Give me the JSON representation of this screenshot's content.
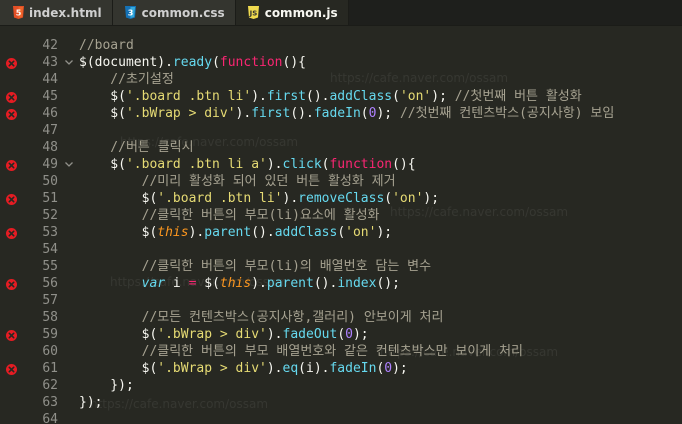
{
  "tabs": [
    {
      "label": "index.html",
      "icon": "html5-icon",
      "active": false
    },
    {
      "label": "common.css",
      "icon": "css3-icon",
      "active": false
    },
    {
      "label": "common.js",
      "icon": "js-icon",
      "active": true
    }
  ],
  "watermark_text": "https://cafe.naver.com/ossam",
  "lines": [
    {
      "num": "42",
      "err": false,
      "fold": false,
      "tokens": [
        {
          "t": "//board",
          "c": "c-cmt"
        }
      ]
    },
    {
      "num": "43",
      "err": true,
      "fold": true,
      "tokens": [
        {
          "t": "$(document).",
          "c": ""
        },
        {
          "t": "ready",
          "c": "c-fn"
        },
        {
          "t": "(",
          "c": ""
        },
        {
          "t": "function",
          "c": "c-kw"
        },
        {
          "t": "(){",
          "c": ""
        }
      ]
    },
    {
      "num": "44",
      "err": false,
      "fold": false,
      "tokens": [
        {
          "t": "    //초기설정",
          "c": "c-cmt"
        }
      ]
    },
    {
      "num": "45",
      "err": true,
      "fold": false,
      "tokens": [
        {
          "t": "    $(",
          "c": ""
        },
        {
          "t": "'.board .btn li'",
          "c": "c-str"
        },
        {
          "t": ").",
          "c": ""
        },
        {
          "t": "first",
          "c": "c-fn"
        },
        {
          "t": "().",
          "c": ""
        },
        {
          "t": "addClass",
          "c": "c-fn"
        },
        {
          "t": "(",
          "c": ""
        },
        {
          "t": "'on'",
          "c": "c-str"
        },
        {
          "t": "); ",
          "c": ""
        },
        {
          "t": "//첫번째 버튼 활성화",
          "c": "c-cmt"
        }
      ]
    },
    {
      "num": "46",
      "err": true,
      "fold": false,
      "tokens": [
        {
          "t": "    $(",
          "c": ""
        },
        {
          "t": "'.bWrap > div'",
          "c": "c-str"
        },
        {
          "t": ").",
          "c": ""
        },
        {
          "t": "first",
          "c": "c-fn"
        },
        {
          "t": "().",
          "c": ""
        },
        {
          "t": "fadeIn",
          "c": "c-fn"
        },
        {
          "t": "(",
          "c": ""
        },
        {
          "t": "0",
          "c": "c-num"
        },
        {
          "t": "); ",
          "c": ""
        },
        {
          "t": "//첫번째 컨텐츠박스(공지사항) 보임",
          "c": "c-cmt"
        }
      ]
    },
    {
      "num": "47",
      "err": false,
      "fold": false,
      "tokens": []
    },
    {
      "num": "48",
      "err": false,
      "fold": false,
      "tokens": [
        {
          "t": "    //버튼 클릭시",
          "c": "c-cmt"
        }
      ]
    },
    {
      "num": "49",
      "err": true,
      "fold": true,
      "tokens": [
        {
          "t": "    $(",
          "c": ""
        },
        {
          "t": "'.board .btn li a'",
          "c": "c-str"
        },
        {
          "t": ").",
          "c": ""
        },
        {
          "t": "click",
          "c": "c-fn"
        },
        {
          "t": "(",
          "c": ""
        },
        {
          "t": "function",
          "c": "c-kw"
        },
        {
          "t": "(){",
          "c": ""
        }
      ]
    },
    {
      "num": "50",
      "err": false,
      "fold": false,
      "tokens": [
        {
          "t": "        //미리 활성화 되어 있던 버튼 활성화 제거",
          "c": "c-cmt"
        }
      ]
    },
    {
      "num": "51",
      "err": true,
      "fold": false,
      "tokens": [
        {
          "t": "        $(",
          "c": ""
        },
        {
          "t": "'.board .btn li'",
          "c": "c-str"
        },
        {
          "t": ").",
          "c": ""
        },
        {
          "t": "removeClass",
          "c": "c-fn"
        },
        {
          "t": "(",
          "c": ""
        },
        {
          "t": "'on'",
          "c": "c-str"
        },
        {
          "t": ");",
          "c": ""
        }
      ]
    },
    {
      "num": "52",
      "err": false,
      "fold": false,
      "tokens": [
        {
          "t": "        //클릭한 버튼의 부모(li)요소에 활성화",
          "c": "c-cmt"
        }
      ]
    },
    {
      "num": "53",
      "err": true,
      "fold": false,
      "tokens": [
        {
          "t": "        $(",
          "c": ""
        },
        {
          "t": "this",
          "c": "c-this"
        },
        {
          "t": ").",
          "c": ""
        },
        {
          "t": "parent",
          "c": "c-fn"
        },
        {
          "t": "().",
          "c": ""
        },
        {
          "t": "addClass",
          "c": "c-fn"
        },
        {
          "t": "(",
          "c": ""
        },
        {
          "t": "'on'",
          "c": "c-str"
        },
        {
          "t": ");",
          "c": ""
        }
      ]
    },
    {
      "num": "54",
      "err": false,
      "fold": false,
      "tokens": []
    },
    {
      "num": "55",
      "err": false,
      "fold": false,
      "tokens": [
        {
          "t": "        //클릭한 버튼의 부모(li)의 배열번호 담는 변수",
          "c": "c-cmt"
        }
      ]
    },
    {
      "num": "56",
      "err": true,
      "fold": false,
      "tokens": [
        {
          "t": "        ",
          "c": ""
        },
        {
          "t": "var",
          "c": "c-var"
        },
        {
          "t": " i ",
          "c": ""
        },
        {
          "t": "=",
          "c": "c-kw"
        },
        {
          "t": " $(",
          "c": ""
        },
        {
          "t": "this",
          "c": "c-this"
        },
        {
          "t": ").",
          "c": ""
        },
        {
          "t": "parent",
          "c": "c-fn"
        },
        {
          "t": "().",
          "c": ""
        },
        {
          "t": "index",
          "c": "c-fn"
        },
        {
          "t": "();",
          "c": ""
        }
      ]
    },
    {
      "num": "57",
      "err": false,
      "fold": false,
      "tokens": []
    },
    {
      "num": "58",
      "err": false,
      "fold": false,
      "tokens": [
        {
          "t": "        //모든 컨텐츠박스(공지사항,갤러리) 안보이게 처리",
          "c": "c-cmt"
        }
      ]
    },
    {
      "num": "59",
      "err": true,
      "fold": false,
      "tokens": [
        {
          "t": "        $(",
          "c": ""
        },
        {
          "t": "'.bWrap > div'",
          "c": "c-str"
        },
        {
          "t": ").",
          "c": ""
        },
        {
          "t": "fadeOut",
          "c": "c-fn"
        },
        {
          "t": "(",
          "c": ""
        },
        {
          "t": "0",
          "c": "c-num"
        },
        {
          "t": ");",
          "c": ""
        }
      ]
    },
    {
      "num": "60",
      "err": false,
      "fold": false,
      "tokens": [
        {
          "t": "        //클릭한 버튼의 부모 배열번호와 같은 컨텐츠박스만 보이게 처리",
          "c": "c-cmt"
        }
      ]
    },
    {
      "num": "61",
      "err": true,
      "fold": false,
      "tokens": [
        {
          "t": "        $(",
          "c": ""
        },
        {
          "t": "'.bWrap > div'",
          "c": "c-str"
        },
        {
          "t": ").",
          "c": ""
        },
        {
          "t": "eq",
          "c": "c-fn"
        },
        {
          "t": "(i).",
          "c": ""
        },
        {
          "t": "fadeIn",
          "c": "c-fn"
        },
        {
          "t": "(",
          "c": ""
        },
        {
          "t": "0",
          "c": "c-num"
        },
        {
          "t": ");",
          "c": ""
        }
      ]
    },
    {
      "num": "62",
      "err": false,
      "fold": false,
      "tokens": [
        {
          "t": "    });",
          "c": ""
        }
      ]
    },
    {
      "num": "63",
      "err": false,
      "fold": false,
      "tokens": [
        {
          "t": "});",
          "c": ""
        }
      ]
    },
    {
      "num": "64",
      "err": false,
      "fold": false,
      "tokens": []
    }
  ]
}
